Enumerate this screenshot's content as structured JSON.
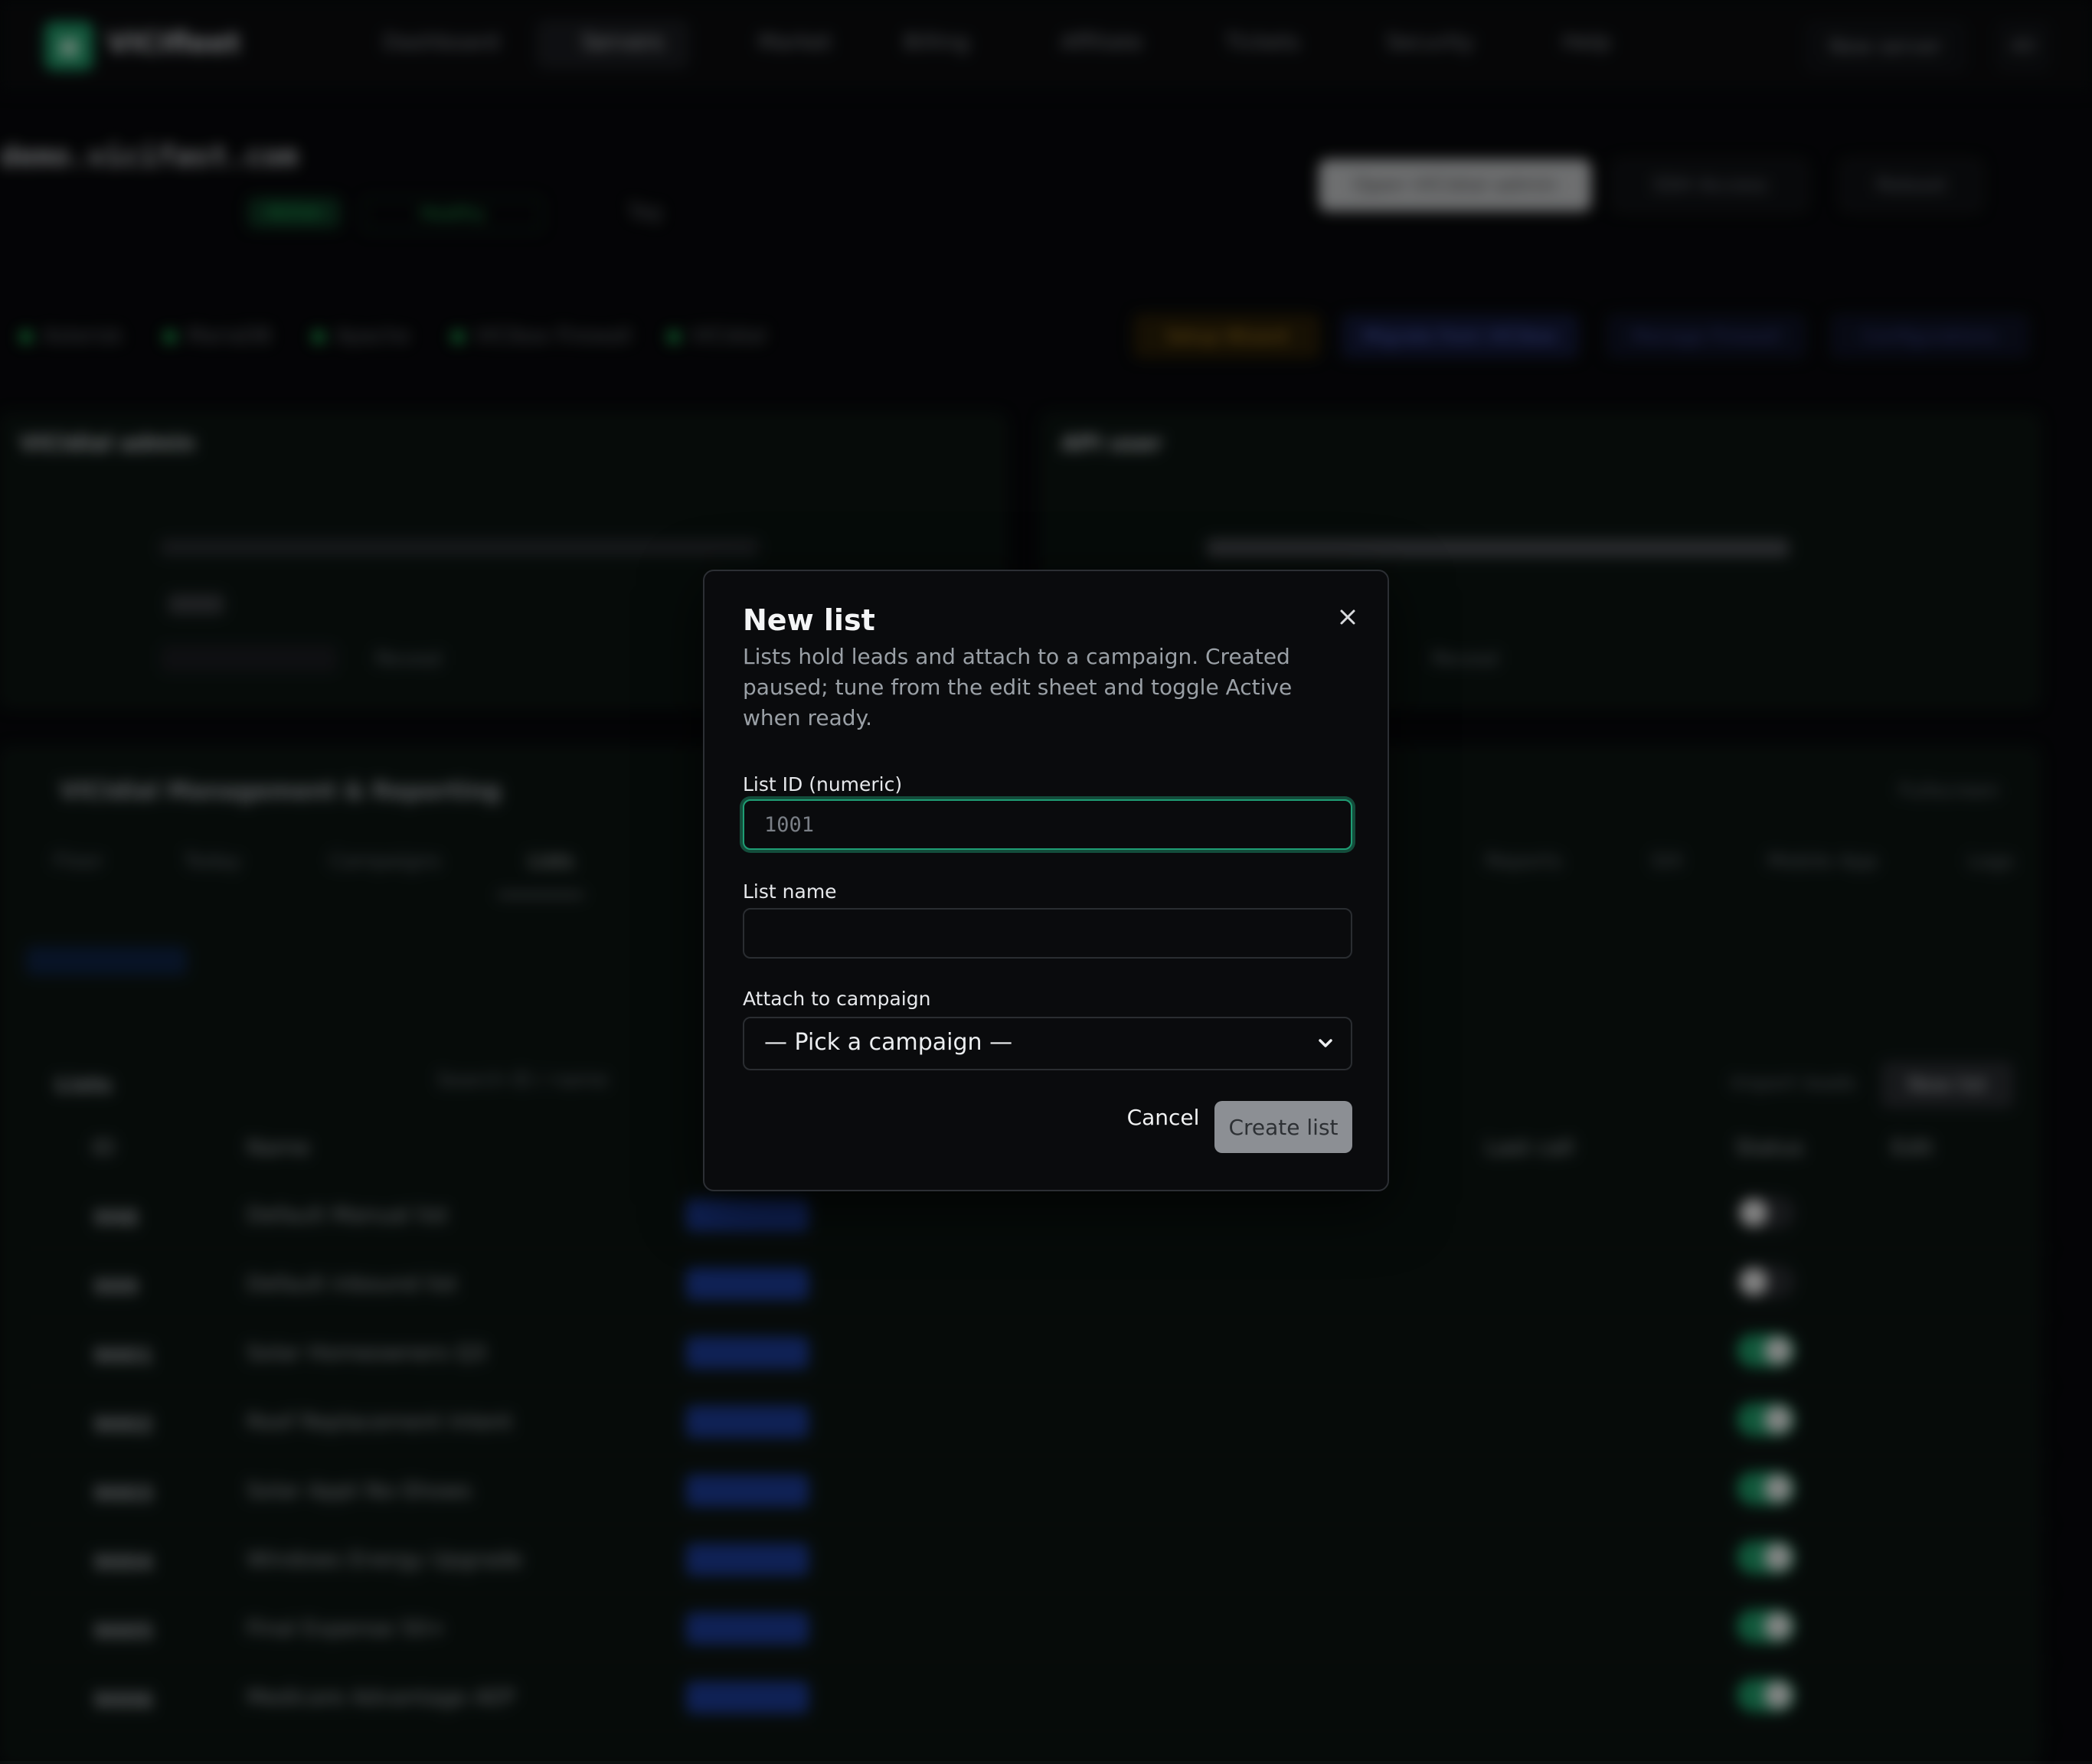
{
  "app": {
    "brand": "VICIfleet",
    "nav": [
      "Dashboard",
      "Servers",
      "Market",
      "Billing",
      "Affiliate",
      "Tickets",
      "Security",
      "Help"
    ],
    "new_server": "New server",
    "avatar": "AD"
  },
  "server": {
    "host": "demo.vicifast.com",
    "status_badge": "Active",
    "health_badge": "Healthy",
    "tag": "Tag",
    "services": [
      "Asterisk",
      "MariaDB",
      "Apache",
      "VICIbox Firewall",
      "VICIdial"
    ],
    "actions": [
      "Open VICIdial admin",
      "SSH Access",
      "Reboot"
    ],
    "tool_buttons": [
      "Setup Wizard",
      "Migrate from VICIbox",
      "Manage Firewall",
      "Configurations"
    ]
  },
  "panels": {
    "admin_title": "VICIdial admin",
    "api_title": "API user",
    "reveal": "Reveal"
  },
  "management": {
    "title": "VICIdial Management & Reporting",
    "fullscreen": "Fullscreen",
    "tabs": [
      "Floor",
      "Today",
      "Campaigns",
      "Lists",
      "Reports",
      "SIX",
      "Mobile App",
      "Logs"
    ],
    "lists_heading": "Lists",
    "search_placeholder": "Search ID / name",
    "import_leads": "Import leads",
    "new_list": "New list",
    "columns": [
      "ID",
      "Name",
      "Last call",
      "Status",
      "Edit"
    ],
    "rows": [
      {
        "id": "998",
        "name": "Default Manual list",
        "on": false
      },
      {
        "id": "999",
        "name": "Default inbound list",
        "on": false
      },
      {
        "id": "9001",
        "name": "Solar Homeowners Q3",
        "on": true
      },
      {
        "id": "9002",
        "name": "Roof Replacement Intent",
        "on": true
      },
      {
        "id": "9003",
        "name": "Solar Appt No-Shows",
        "on": true
      },
      {
        "id": "9004",
        "name": "Windows Energy Upgrade",
        "on": true
      },
      {
        "id": "9005",
        "name": "Final Expense 50+",
        "on": true
      },
      {
        "id": "9006",
        "name": "Medicare Advantage AEP",
        "on": true
      }
    ]
  },
  "modal": {
    "title": "New list",
    "description": "Lists hold leads and attach to a campaign. Created paused; tune from the edit sheet and toggle Active when ready.",
    "list_id_label": "List ID (numeric)",
    "list_id_placeholder": "1001",
    "list_id_value": "",
    "list_name_label": "List name",
    "list_name_value": "",
    "campaign_label": "Attach to campaign",
    "campaign_selected": "— Pick a campaign —",
    "cancel_label": "Cancel",
    "create_label": "Create list"
  },
  "colors": {
    "accent": "#1f9d74",
    "modal_bg": "#0a0b0d",
    "create_disabled": "#8c8f94"
  },
  "icons": [
    "close-icon",
    "chevron-down-icon"
  ]
}
